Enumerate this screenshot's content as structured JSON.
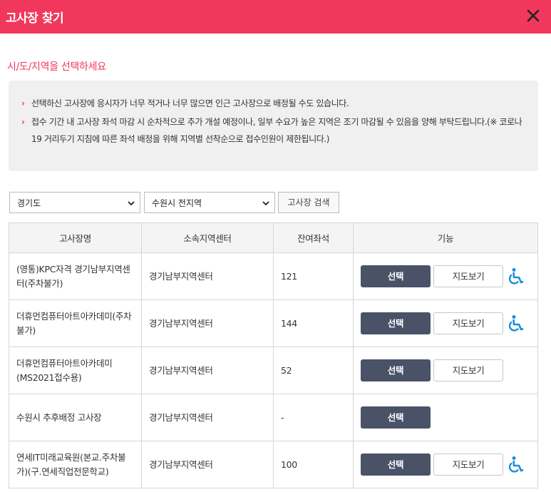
{
  "header": {
    "title": "고사장 찾기"
  },
  "subtitle": "시/도/지역을 선택하세요",
  "notices": [
    "선택하신 고사장에 응시자가 너무 적거나 너무 많으면 인근 고사장으로 배정될 수도 있습니다.",
    "접수 기간 내 고사장 좌석 마감 시 순차적으로 추가 개설 예정이나, 일부 수요가 높은 지역은 조기 마감될 수 있음을 양해 부탁드립니다.(※ 코로나19 거리두기 지침에 따른 좌석 배정을 위해 지역별 선착순으로 접수인원이 제한됩니다.)"
  ],
  "filters": {
    "province": "경기도",
    "city": "수원시 전지역",
    "search_label": "고사장 검색"
  },
  "table": {
    "headers": [
      "고사장명",
      "소속지역센터",
      "잔여좌석",
      "기능"
    ],
    "select_label": "선택",
    "map_label": "지도보기",
    "rows": [
      {
        "name": "(영통)KPC자격 경기남부지역센터(주차불가)",
        "center": "경기남부지역센터",
        "seats": "121"
      },
      {
        "name": "더휴먼컴퓨터아트아카데미(주차불가)",
        "center": "경기남부지역센터",
        "seats": "144"
      },
      {
        "name": "더휴먼컴퓨터아트아카데미(MS2021접수용)",
        "center": "경기남부지역센터",
        "seats": "52"
      },
      {
        "name": "수원시 추후배정 고사장",
        "center": "경기남부지역센터",
        "seats": "-"
      },
      {
        "name": "연세IT미래교육원(본교.주차불가)(구.연세직업전문학교)",
        "center": "경기남부지역센터",
        "seats": "100"
      }
    ]
  },
  "colors": {
    "accent": "#f2375c",
    "button_dark": "#4a5268",
    "wheelchair": "#1a8fd6"
  },
  "icons": {
    "close": "close-icon",
    "dropdown": "chevron-down-icon",
    "notice": "chevron-right-icon",
    "accessibility": "wheelchair-icon"
  }
}
